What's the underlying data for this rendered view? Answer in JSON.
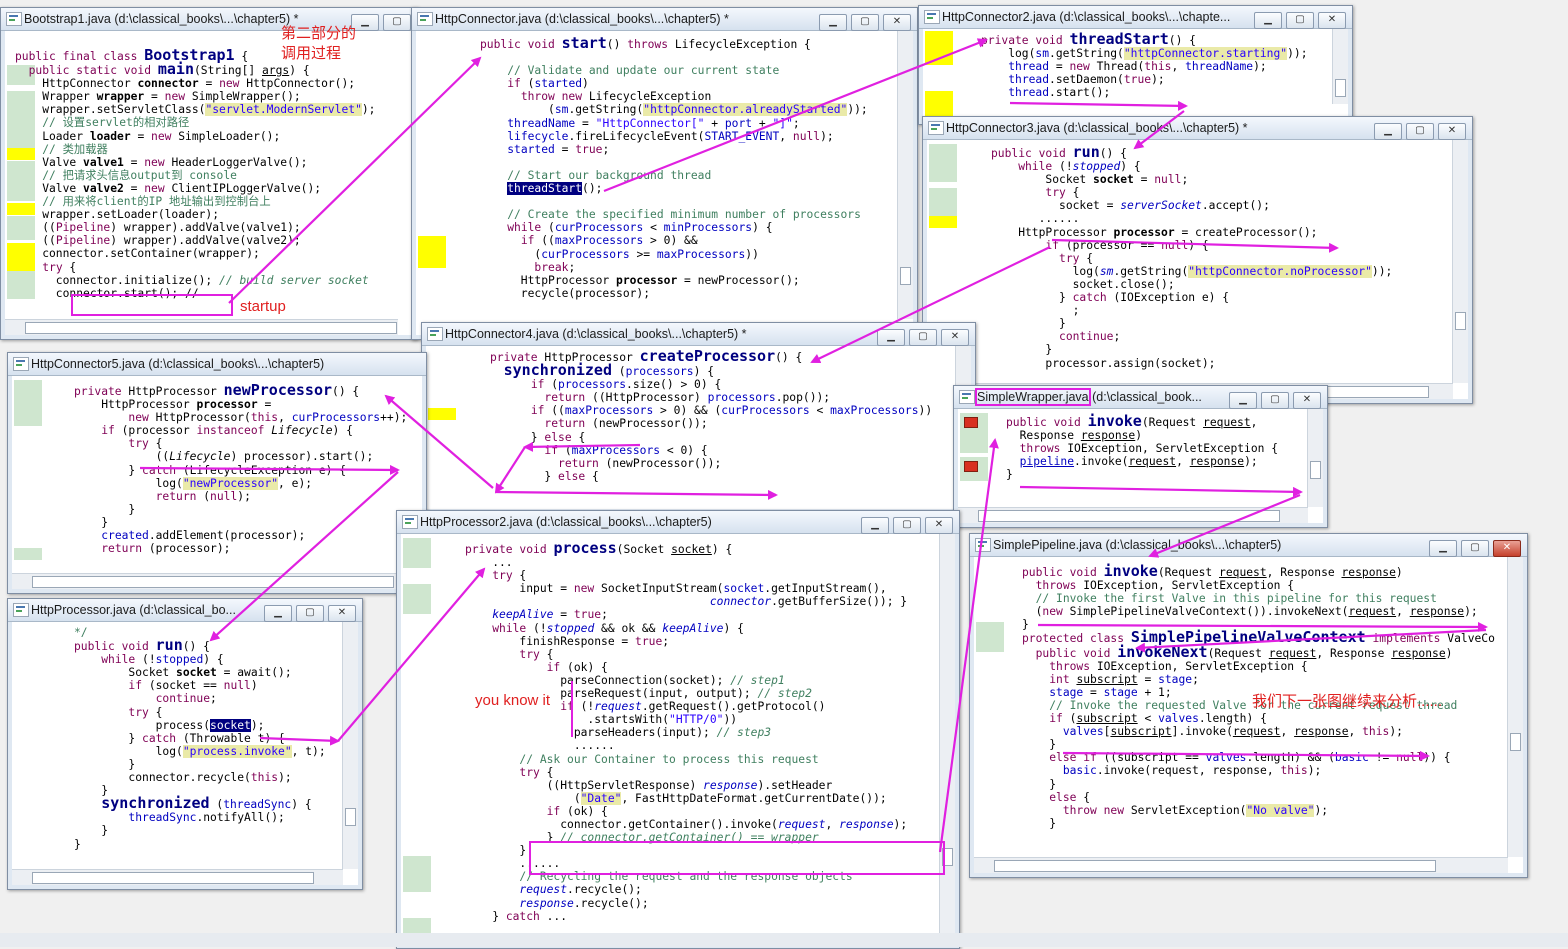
{
  "windows": {
    "bootstrap1": {
      "title": "Bootstrap1.java (d:\\classical_books\\...\\chapter5) *"
    },
    "httpconnector": {
      "title": "HttpConnector.java (d:\\classical_books\\...\\chapter5) *"
    },
    "httpconnector2": {
      "title": "HttpConnector2.java (d:\\classical_books\\...\\chapte..."
    },
    "httpconnector3": {
      "title": "HttpConnector3.java (d:\\classical_books\\...\\chapter5) *"
    },
    "httpconnector4": {
      "title": "HttpConnector4.java (d:\\classical_books\\...\\chapter5) *"
    },
    "httpconnector5": {
      "title": "HttpConnector5.java (d:\\classical_books\\...\\chapter5)"
    },
    "simplewrapper": {
      "title_file": "SimpleWrapper.java",
      "title_rest": " (d:\\classical_book..."
    },
    "httpprocessor": {
      "title": "HttpProcessor.java (d:\\classical_bo..."
    },
    "httpprocessor2": {
      "title": "HttpProcessor2.java (d:\\classical_books\\...\\chapter5)"
    },
    "simplepipeline": {
      "title": "SimplePipeline.java (d:\\classical_books\\...\\chapter5)"
    }
  },
  "window_buttons": {
    "minimize": "▁",
    "maximize": "▢",
    "close": "✕"
  },
  "annotations": {
    "part_two": "第二部分的",
    "call_process": "调用过程",
    "startup": "startup",
    "you_know_it": "you know it",
    "next_figure": "我们下一张图继续来分析......"
  },
  "colors": {
    "arrow": "#e020e0",
    "note_text": "#e02020",
    "keyword": "#7f0055",
    "comment": "#3f7f5f",
    "string": "#2a00ff",
    "field": "#0000c0"
  },
  "icons": [
    "java-file-icon",
    "scroll-arrow-icon",
    "breakpoint-marker-icon"
  ]
}
